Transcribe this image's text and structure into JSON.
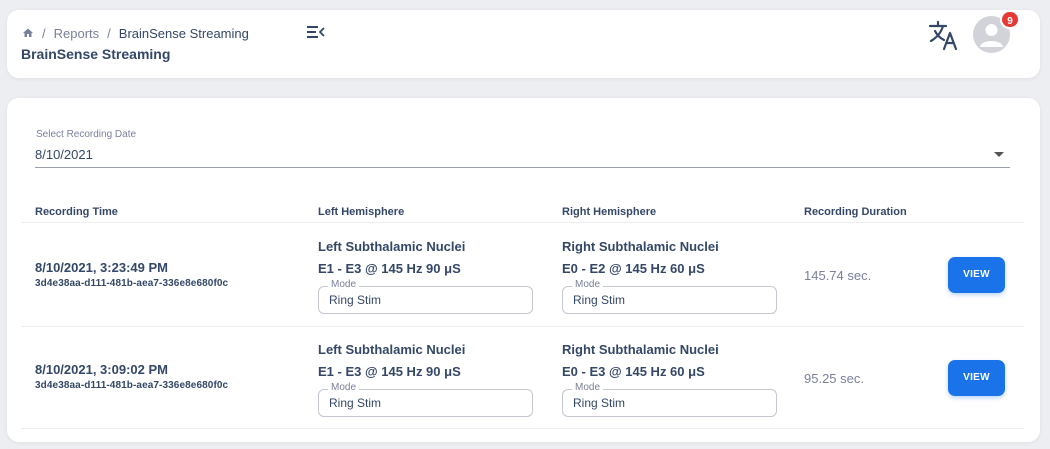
{
  "breadcrumb": {
    "home_icon": "home-icon",
    "separator": "/",
    "items": [
      "Reports",
      "BrainSense Streaming"
    ]
  },
  "header": {
    "title": "BrainSense Streaming",
    "menu_icon": "menu-collapse-icon",
    "translate_icon": "translate-icon",
    "avatar_icon": "user-avatar-icon",
    "notification_count": "9"
  },
  "recording_select": {
    "label": "Select Recording Date",
    "value": "8/10/2021"
  },
  "table": {
    "headers": [
      "Recording Time",
      "Left Hemisphere",
      "Right Hemisphere",
      "Recording Duration"
    ],
    "mode_label": "Mode",
    "view_label": "VIEW",
    "rows": [
      {
        "time": "8/10/2021, 3:23:49 PM",
        "id": "3d4e38aa-d111-481b-aea7-336e8e680f0c",
        "left_title": "Left Subthalamic Nuclei",
        "left_setting": "E1 - E3 @ 145 Hz 90 μS",
        "left_mode": "Ring Stim",
        "right_title": "Right Subthalamic Nuclei",
        "right_setting": "E0 - E2 @ 145 Hz 60 μS",
        "right_mode": "Ring Stim",
        "duration": "145.74 sec."
      },
      {
        "time": "8/10/2021, 3:09:02 PM",
        "id": "3d4e38aa-d111-481b-aea7-336e8e680f0c",
        "left_title": "Left Subthalamic Nuclei",
        "left_setting": "E1 - E3 @ 145 Hz 90 μS",
        "left_mode": "Ring Stim",
        "right_title": "Right Subthalamic Nuclei",
        "right_setting": "E0 - E3 @ 145 Hz 60 μS",
        "right_mode": "Ring Stim",
        "duration": "95.25 sec."
      }
    ]
  },
  "colors": {
    "primary": "#1a73e8",
    "badge": "#e53935",
    "text": "#344767",
    "muted": "#7b809a",
    "background": "#eceef1"
  }
}
